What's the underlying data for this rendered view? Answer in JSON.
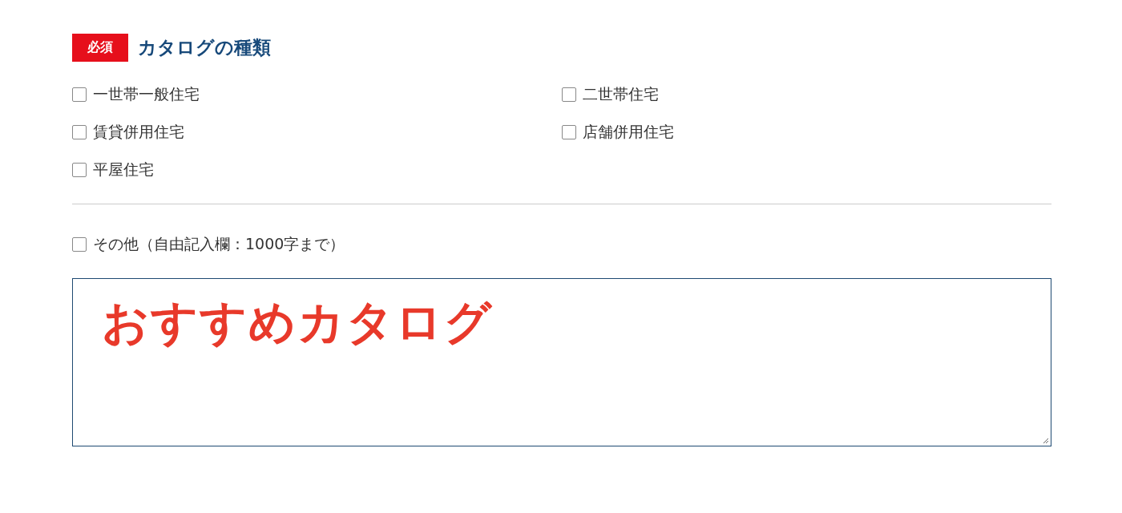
{
  "heading": {
    "badge": "必須",
    "title": "カタログの種類"
  },
  "options": [
    {
      "label": "一世帯一般住宅",
      "checked": false
    },
    {
      "label": "二世帯住宅",
      "checked": false
    },
    {
      "label": "賃貸併用住宅",
      "checked": false
    },
    {
      "label": "店舗併用住宅",
      "checked": false
    },
    {
      "label": "平屋住宅",
      "checked": false
    }
  ],
  "other": {
    "label": "その他（自由記入欄：1000字まで）",
    "checked": false
  },
  "free_text": {
    "value": "おすすめカタログ"
  }
}
